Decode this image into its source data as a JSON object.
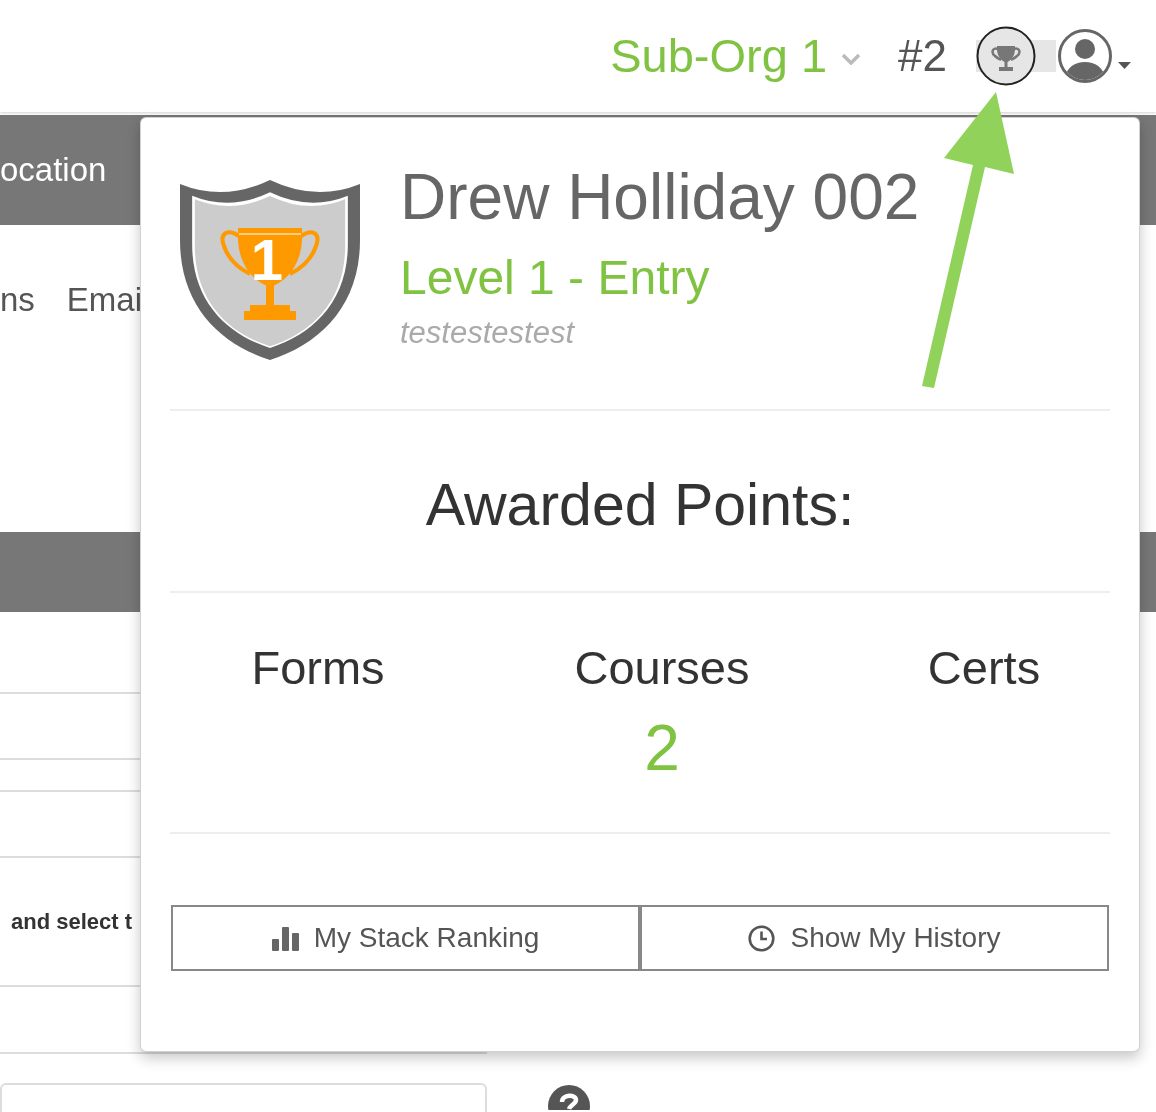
{
  "header": {
    "org_selector": {
      "label": "Sub-Org 1"
    },
    "rank": "#2",
    "awards_button": {
      "active": true
    }
  },
  "background_page": {
    "section_title": "ocation",
    "tabs": [
      "ns",
      "Emai"
    ],
    "instruction_text": "and select t"
  },
  "awards_popover": {
    "badge": {
      "level_number": "1"
    },
    "user_name": "Drew Holliday 002",
    "level": "Level 1 - Entry",
    "subtitle": "testestestest",
    "heading": "Awarded Points:",
    "point_columns": [
      {
        "label": "Forms"
      },
      {
        "label": "Courses",
        "value": "2"
      },
      {
        "label": "Certs"
      }
    ],
    "buttons": [
      {
        "kind": "ranking",
        "label": "My Stack Ranking"
      },
      {
        "kind": "history",
        "label": "Show My History"
      }
    ]
  }
}
